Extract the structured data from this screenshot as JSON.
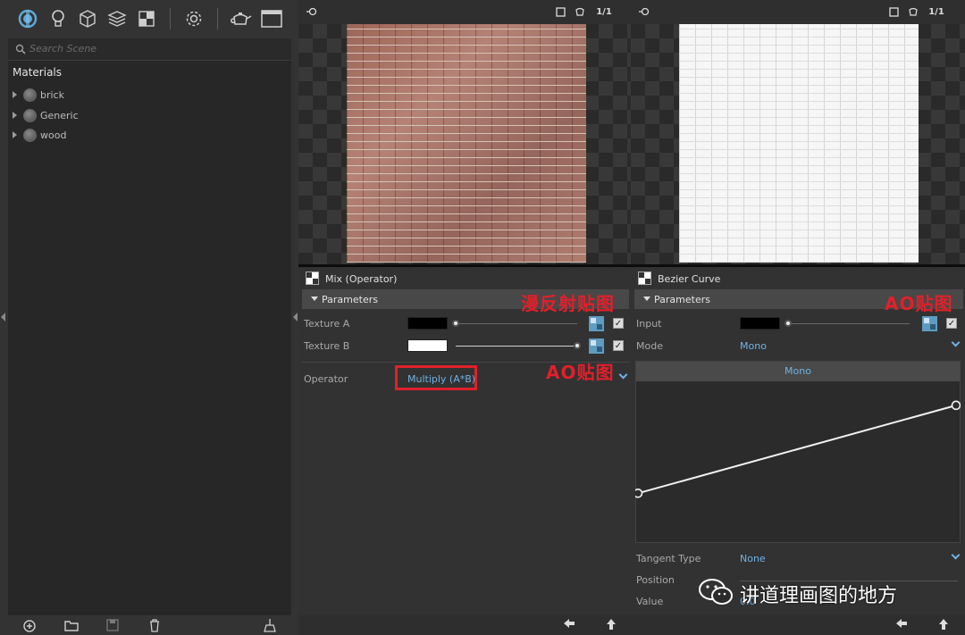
{
  "toolbar": {
    "icons": [
      "scene-icon",
      "light-bulb-icon",
      "cube-icon",
      "layers-icon",
      "texture-icon",
      "gear-icon",
      "teapot-icon",
      "window-icon"
    ]
  },
  "scene": {
    "search_placeholder": "Search Scene",
    "section_title": "Materials",
    "materials": [
      "brick",
      "Generic",
      "wood"
    ]
  },
  "viewport_left": {
    "ratio_label": "1/1"
  },
  "viewport_right": {
    "ratio_label": "1/1"
  },
  "mix_panel": {
    "title": "Mix (Operator)",
    "section": "Parameters",
    "texture_a_label": "Texture A",
    "texture_b_label": "Texture B",
    "texture_a_slider": 0.0,
    "texture_b_slider": 1.0,
    "operator_label": "Operator",
    "operator_value": "Multiply (A*B)",
    "annotation_diffuse": "漫反射贴图",
    "annotation_ao": "AO贴图"
  },
  "bezier_panel": {
    "title": "Bezier Curve",
    "section": "Parameters",
    "input_label": "Input",
    "input_slider": 0.0,
    "mode_label": "Mode",
    "mode_value": "Mono",
    "curve_header": "Mono",
    "curve_start": [
      0.0,
      0.3
    ],
    "curve_end": [
      1.0,
      0.85
    ],
    "tangent_label": "Tangent Type",
    "tangent_value": "None",
    "position_label": "Position",
    "value_label": "Value",
    "value_value": "0.0",
    "annotation_ao": "AO贴图"
  },
  "watermark": {
    "text": "讲道理画图的地方"
  },
  "colors": {
    "accent": "#6fb2e4",
    "annotation": "#e0202a"
  }
}
